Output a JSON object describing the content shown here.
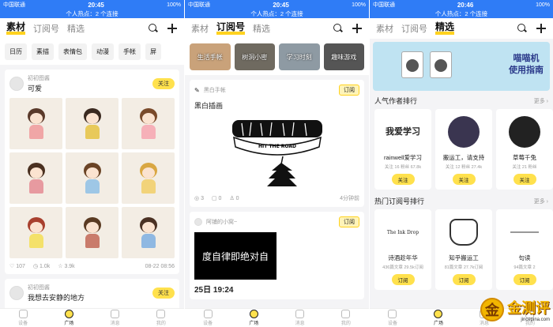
{
  "screens": [
    {
      "status": {
        "carrier": "中国联通",
        "network": "4G",
        "time": "20:45",
        "battery": "100%"
      },
      "hotspot": "个人热点：2 个连接",
      "tabs": [
        "素材",
        "订阅号",
        "精选"
      ],
      "chips": [
        "日历",
        "素描",
        "表情包",
        "动漫",
        "手帐",
        "屏"
      ],
      "post": {
        "author": "初初图酱",
        "title": "可爱",
        "follow": "关注",
        "likes": "107",
        "views": "1.0k",
        "collects": "3.9k",
        "date": "08-22 08:56"
      },
      "post2": {
        "author": "初初图酱",
        "title": "我想去安静的地方",
        "follow": "关注"
      }
    },
    {
      "status": {
        "carrier": "中国联通",
        "network": "4G",
        "time": "20:45",
        "battery": "100%"
      },
      "hotspot": "个人热点：2 个连接",
      "tabs": [
        "素材",
        "订阅号",
        "精选"
      ],
      "categories": [
        "生活手帐",
        "树洞小密",
        "学习时刻",
        "趣味游戏"
      ],
      "sub1": {
        "author": "黑白手帐",
        "btn": "订阅",
        "title": "黑白插画",
        "road": "HIT THE ROAD",
        "likes": "3",
        "comments": "0",
        "collects": "0",
        "time": "4分钟前"
      },
      "sub2": {
        "author": "阿铺的小窝~",
        "btn": "订阅",
        "banner": "度自律即绝对自",
        "date": "25日 19:24"
      }
    },
    {
      "status": {
        "carrier": "中国联通",
        "network": "4G",
        "time": "20:46",
        "battery": "100%"
      },
      "hotspot": "个人热点：2 个连接",
      "tabs": [
        "素材",
        "订阅号",
        "精选"
      ],
      "banner": {
        "line1": "喵喵机",
        "line2": "使用指南"
      },
      "writers_title": "人气作者排行",
      "writers_more": "更多",
      "writers": [
        {
          "big": "我爱学习",
          "name": "rainwell爱学习",
          "stats": "关注 16 粉丝 67.8k",
          "btn": "关注"
        },
        {
          "big": "",
          "name": "搬运工，请支持",
          "stats": "关注 12 粉丝 27.4k",
          "btn": "关注"
        },
        {
          "big": "",
          "name": "草莓千兔",
          "stats": "关注 21 粉丝",
          "btn": "关注"
        }
      ],
      "subs_title": "热门订阅号排行",
      "subs_more": "更多",
      "subs": [
        {
          "big": "The Ink Drop",
          "name": "诗酒趁年华",
          "stats": "436篇文章  29.5k订阅",
          "btn": "订阅"
        },
        {
          "big": "",
          "name": "知乎搬运工",
          "stats": "81篇文章  27.7k订阅",
          "btn": "订阅"
        },
        {
          "big": "",
          "name": "句读",
          "stats": "94篇文章  2",
          "btn": "订阅"
        }
      ],
      "watermark": {
        "coin": "金",
        "text": "金测评",
        "url": "jincepina.com"
      }
    }
  ],
  "tabbar": [
    "设备",
    "广场",
    "消息",
    "我的"
  ]
}
